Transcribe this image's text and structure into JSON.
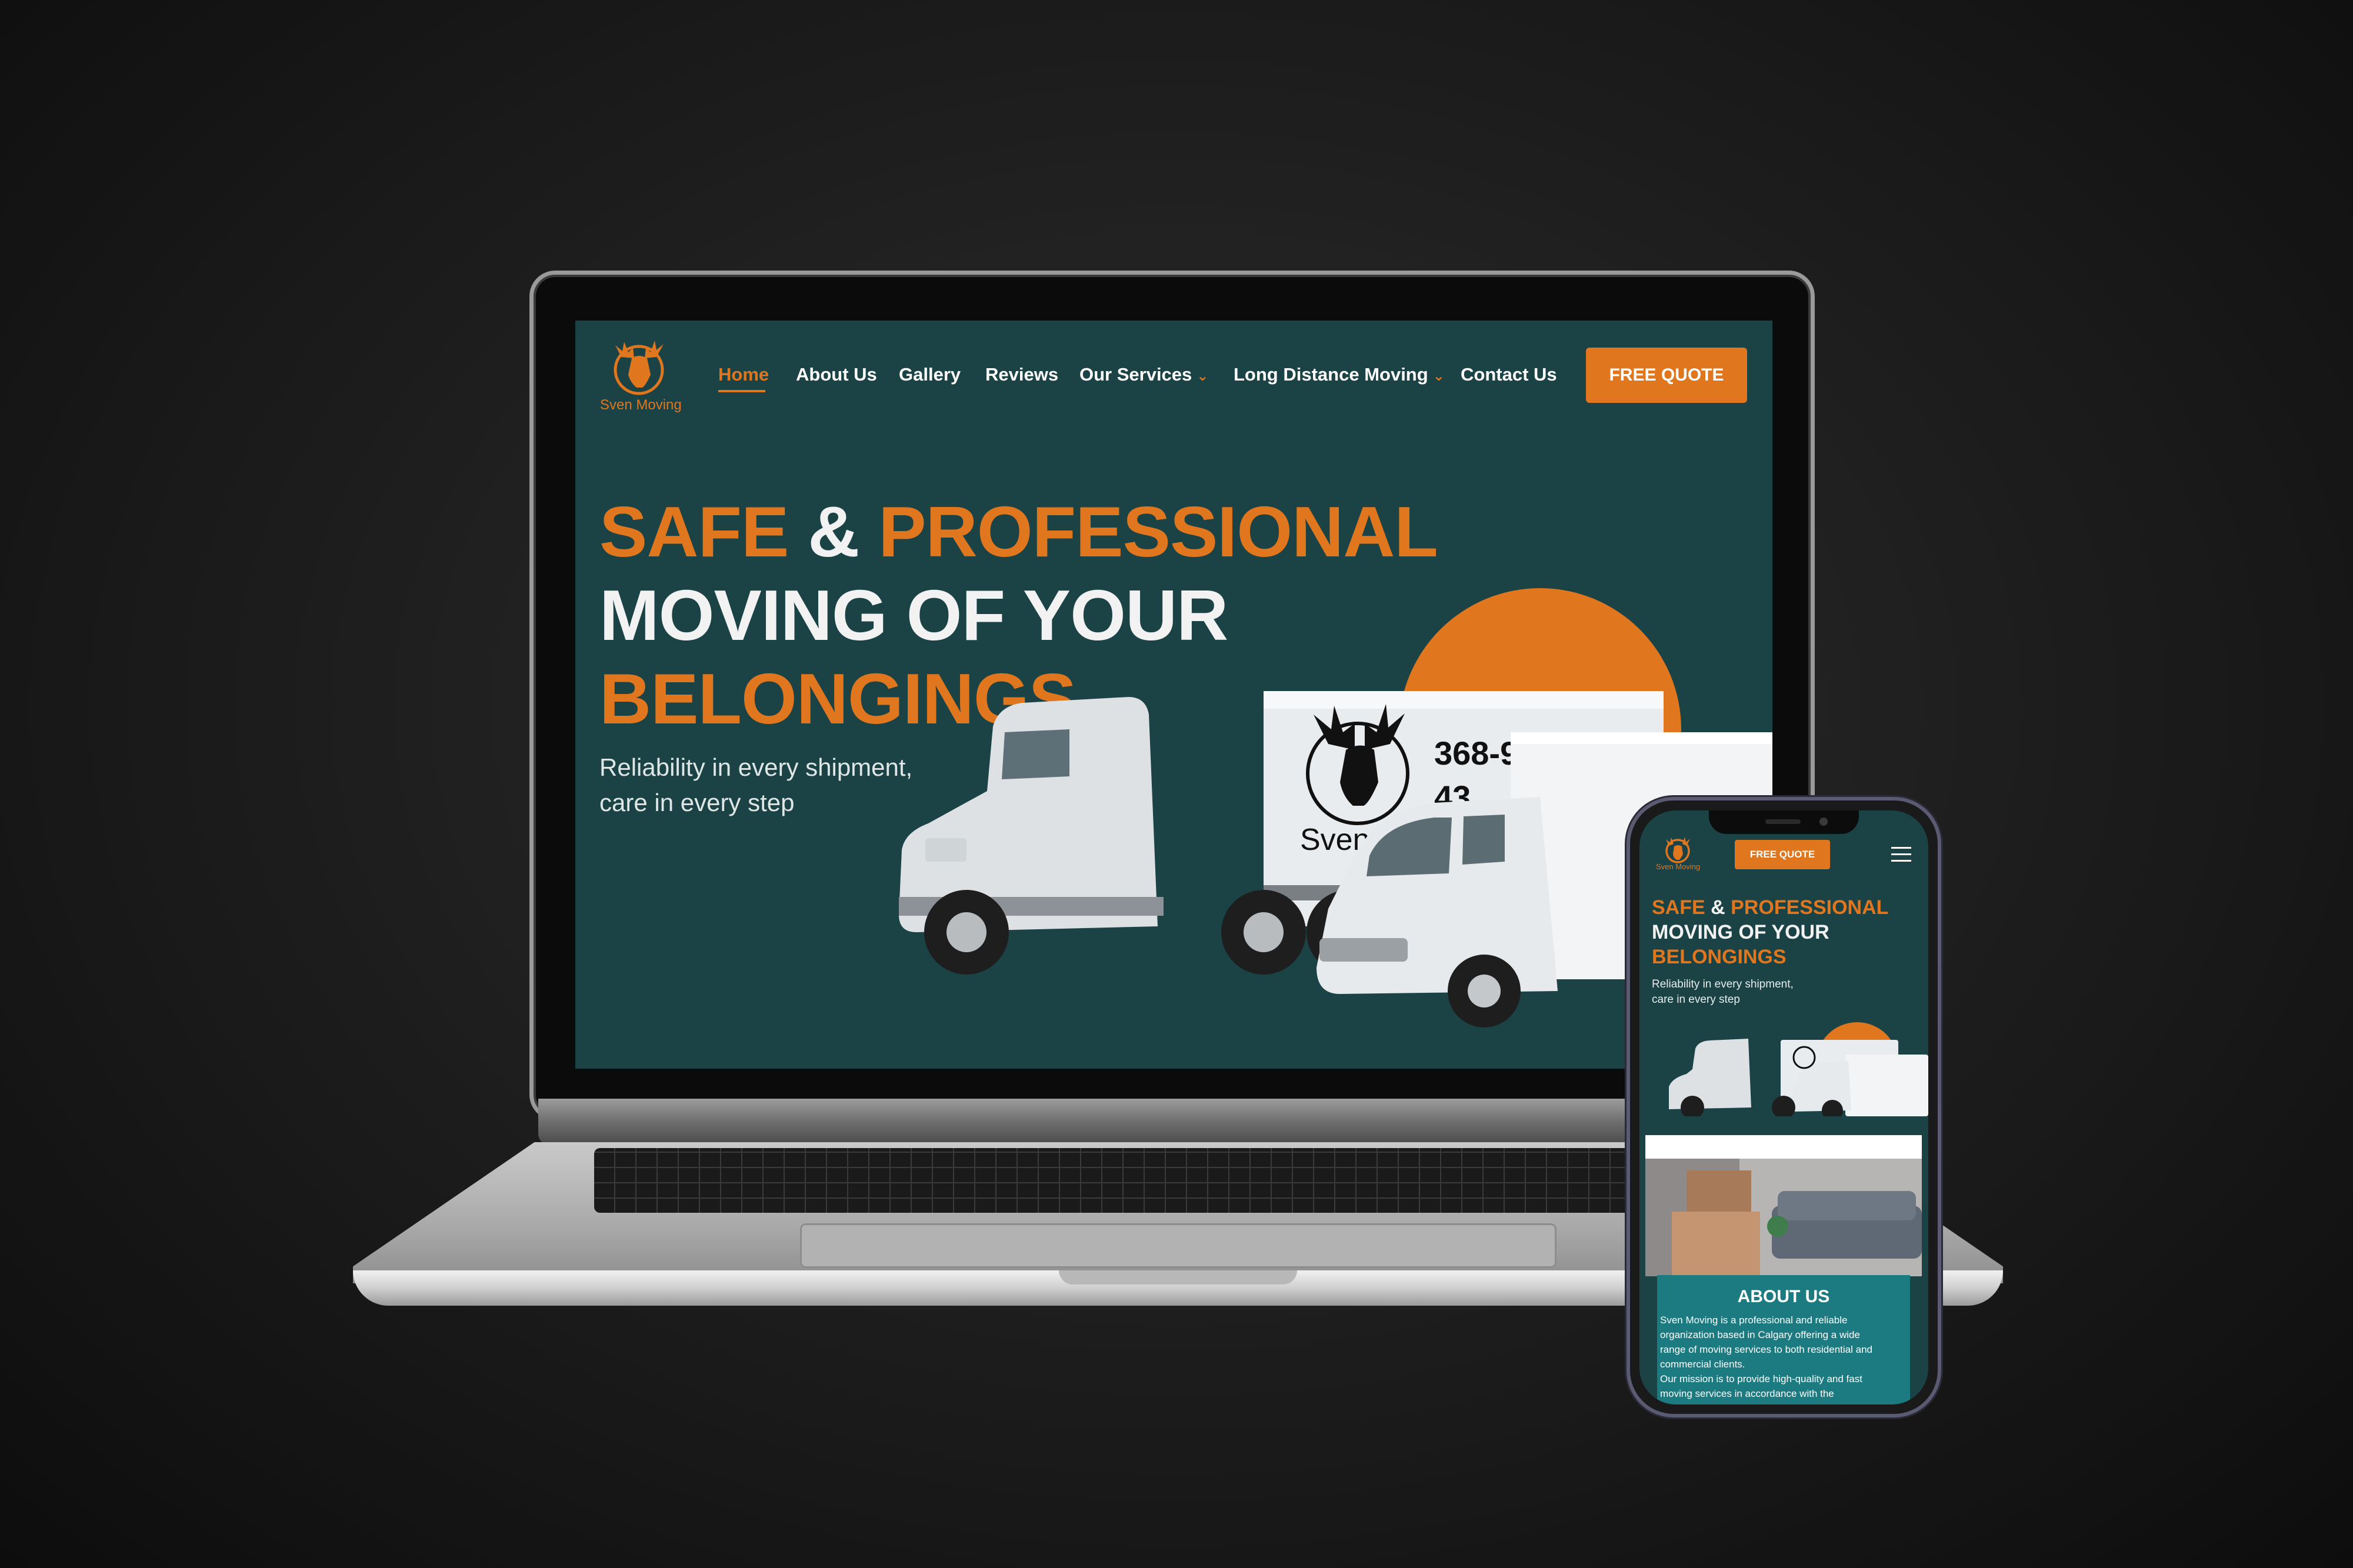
{
  "brand": {
    "name": "Sven Moving",
    "logo_icon": "moose-icon",
    "accent_color": "#e0761d",
    "background_color": "#1b4346"
  },
  "nav": {
    "items": [
      {
        "label": "Home",
        "active": true
      },
      {
        "label": "About Us"
      },
      {
        "label": "Gallery"
      },
      {
        "label": "Reviews"
      },
      {
        "label": "Our Services",
        "dropdown": true
      },
      {
        "label": "Long Distance Moving",
        "dropdown": true
      },
      {
        "label": "Contact Us"
      }
    ],
    "cta_label": "FREE QUOTE"
  },
  "hero": {
    "word_safe": "SAFE",
    "word_amp": "&",
    "word_professional": "PROFESSIONAL",
    "line2": "MOVING OF YOUR",
    "line3": "BELONGINGS",
    "subtitle_line1": "Reliability in every shipment,",
    "subtitle_line2": "care in every step"
  },
  "truck": {
    "phone_partial_1": "368-9",
    "phone_partial_2": "43",
    "brand_text": "Sven Moving"
  },
  "mobile": {
    "cta_label": "FREE QUOTE",
    "menu_icon": "hamburger-menu-icon",
    "about": {
      "title": "ABOUT US",
      "lines": [
        "Sven Moving is a professional and reliable",
        "organization based in Calgary offering a wide",
        "range of moving services to both residential and",
        "commercial clients.",
        "Our mission is to provide high-quality and fast",
        "moving services in accordance with the"
      ]
    }
  }
}
